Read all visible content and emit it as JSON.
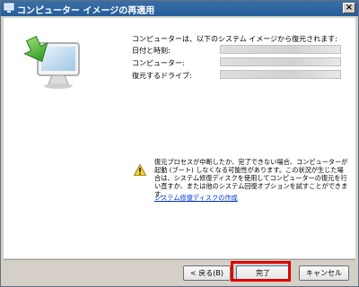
{
  "window": {
    "title": "コンピューター イメージの再適用",
    "close_glyph": "×"
  },
  "main": {
    "heading": "コンピューターは、以下のシステム イメージから復元されます:",
    "fields": [
      {
        "label": "日付と時刻:",
        "value": ""
      },
      {
        "label": "コンピューター:",
        "value": ""
      },
      {
        "label": "復元するドライブ:",
        "value": ""
      }
    ],
    "warning_text": "復元プロセスが中断したか、完了できない場合、コンピューターが起動 (ブート) しなくなる可能性があります。この状況が生じた場合は、システム修復ディスクを使用してコンピューターの復元を行い直すか、または他のシステム回復オプションを試すことができます。",
    "warning_link": "システム修復ディスクの作成"
  },
  "buttons": {
    "back": "< 戻る(B)",
    "finish": "完了",
    "cancel": "キャンセル"
  },
  "colors": {
    "highlight": "#e00000",
    "titlebar": "#255e9a",
    "link": "#0033cc"
  }
}
